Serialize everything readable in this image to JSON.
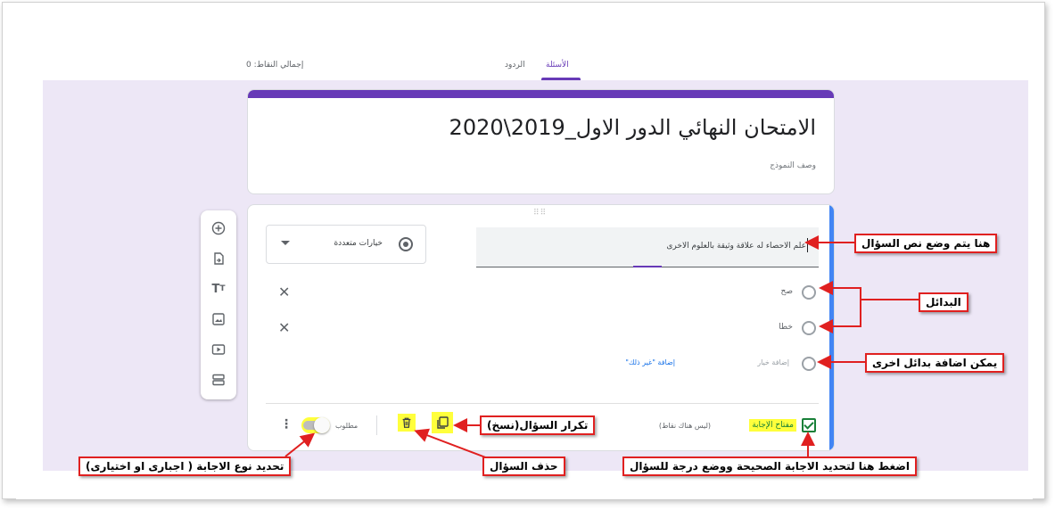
{
  "tabs": {
    "questions": "الأسئلة",
    "responses": "الردود",
    "total_points": "إجمالي النقاط: 0"
  },
  "form": {
    "title": "الامتحان النهائي الدور الاول_2019\\2020",
    "description": "وصف النموذج"
  },
  "question": {
    "text": "علم الاحصاء له علاقة وثيقة بالعلوم الاخرى",
    "type_label": "خيارات متعددة",
    "options": [
      "صح",
      "خطا"
    ],
    "add_option_label": "إضافة خيار",
    "add_other_label": "إضافة \"غير ذلك\"",
    "answer_key_label": "مفتاح الإجابة",
    "points_note": "(ليس هناك نقاط)",
    "required_label": "مطلوب",
    "required": true
  },
  "side_toolbar": [
    "add-question-icon",
    "import-questions-icon",
    "title-description-icon",
    "image-icon",
    "video-icon",
    "section-icon"
  ],
  "annotations": {
    "question_text": "هنا يتم وضع نص السؤال",
    "options": "البدائل",
    "add_options": "يمكن اضافة بدائل اخرى",
    "duplicate": "تكرار السؤال(نسخ)",
    "answer_key": "اضغط هنا لتحديد الاجابة الصحيحة ووضع درجة للسؤال",
    "delete": "حذف السؤال",
    "required_type": "تحديد نوع الاجابة ( اجبارى او اختيارى)"
  },
  "colors": {
    "accent_purple": "#673ab7",
    "canvas_bg": "#ede7f6",
    "focus_blue": "#4285f4",
    "annotation_red": "#e02020",
    "highlight_yellow": "#ffff3c"
  }
}
